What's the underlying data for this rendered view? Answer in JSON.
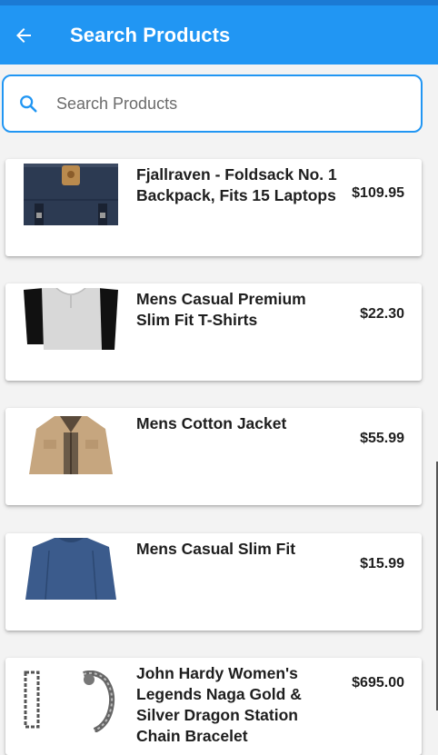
{
  "app_bar": {
    "title": "Search Products",
    "back_icon": "arrow-left-icon",
    "background": "#2196f3"
  },
  "search": {
    "placeholder": "Search Products",
    "value": "",
    "icon": "search-icon"
  },
  "products": [
    {
      "name": "Fjallraven - Foldsack No. 1 Backpack, Fits 15 Laptops",
      "price": "$109.95",
      "image": "backpack"
    },
    {
      "name": "Mens Casual Premium Slim Fit T-Shirts",
      "price": "$22.30",
      "image": "t-shirt"
    },
    {
      "name": "Mens Cotton Jacket",
      "price": "$55.99",
      "image": "jacket"
    },
    {
      "name": "Mens Casual Slim Fit",
      "price": "$15.99",
      "image": "long-sleeve-shirt"
    },
    {
      "name": "John Hardy Women's Legends Naga Gold & Silver Dragon Station Chain Bracelet",
      "price": "$695.00",
      "image": "bracelet"
    }
  ]
}
